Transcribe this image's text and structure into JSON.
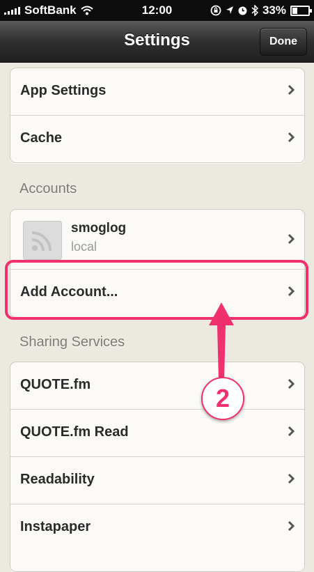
{
  "status_bar": {
    "carrier": "SoftBank",
    "time": "12:00",
    "battery": "33%",
    "battery_level": 0.33
  },
  "nav": {
    "title": "Settings",
    "done_label": "Done"
  },
  "general": [
    {
      "label": "App Settings"
    },
    {
      "label": "Cache"
    }
  ],
  "accounts": {
    "header": "Accounts",
    "items": [
      {
        "name": "smoglog",
        "type": "local",
        "icon": "rss-icon"
      }
    ],
    "add_label": "Add Account..."
  },
  "sharing": {
    "header": "Sharing Services",
    "items": [
      {
        "label": "QUOTE.fm"
      },
      {
        "label": "QUOTE.fm Read"
      },
      {
        "label": "Readability"
      },
      {
        "label": "Instapaper"
      }
    ]
  },
  "annotation": {
    "step": "2",
    "color": "#f0306f"
  }
}
